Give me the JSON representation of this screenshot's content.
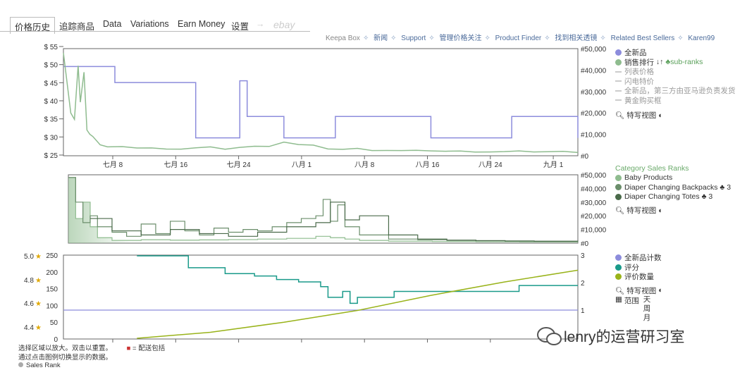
{
  "tabs": [
    "价格历史",
    "追踪商品",
    "Data",
    "Variations",
    "Earn Money",
    "设置",
    "→",
    "ebay"
  ],
  "toplinks": [
    "Keepa Box",
    "新闻",
    "Support",
    "管理价格关注",
    "Product Finder",
    "找到相关透镜",
    "Related Best Sellers",
    "Karen99"
  ],
  "main_legend": {
    "items": [
      "全新品",
      "销售排行",
      "sub-ranks",
      "列表价格",
      "闪电特价",
      "全新品，第三方由亚马逊负责发货",
      "黄金购买框"
    ],
    "sort_icon": "↓↑",
    "view": "特写视图"
  },
  "cat_legend": {
    "title": "Category Sales Ranks",
    "items": [
      "Baby Products",
      "Diaper Changing Backpacks",
      "Diaper Changing Totes"
    ],
    "counts": [
      "3",
      "3"
    ],
    "view": "特写视图"
  },
  "bottom_legend": {
    "items": [
      "全新品计数",
      "评分",
      "评价数量"
    ],
    "view": "特写视图",
    "range_label": "范围",
    "range_value": "天周月"
  },
  "notes": {
    "line1": "选择区域以放大。双击以重置。",
    "prime_legend": "= 配送包括",
    "line2": "通过点击图例切换显示的数据。",
    "line3": "Sales Rank"
  },
  "watermark": "lenry的运营研习室",
  "colors": {
    "new": "#8c8cdc",
    "salesrank": "#8fbc8f",
    "baby": "#8fbc8f",
    "backpacks": "#6b8e6b",
    "totes": "#4a6a4a",
    "count": "#8c8cdc",
    "rating": "#1a9a8a",
    "reviews": "#99b31a",
    "accent": "#5aa05a"
  },
  "chart_data": [
    {
      "type": "line",
      "title": "",
      "x_ticks": [
        "七月 8",
        "七月 16",
        "七月 24",
        "八月 1",
        "八月 8",
        "八月 16",
        "八月 24",
        "九月 1"
      ],
      "y_left_ticks": [
        "$ 25",
        "$ 30",
        "$ 35",
        "$ 40",
        "$ 45",
        "$ 50",
        "$ 55"
      ],
      "y_right_ticks": [
        "#0",
        "#10,000",
        "#20,000",
        "#30,000",
        "#40,000",
        "#50,000"
      ],
      "ylim_left": [
        25,
        55
      ],
      "ylim_right": [
        0,
        50000
      ],
      "series": [
        {
          "name": "全新品",
          "axis": "left",
          "step": true,
          "x": [
            0,
            7,
            14,
            18,
            20,
            24,
            25,
            30,
            37,
            44,
            50,
            55,
            61,
            63,
            70
          ],
          "y": [
            50,
            45.5,
            45.5,
            30,
            30,
            46,
            36,
            30,
            36,
            36,
            30,
            30,
            36,
            36,
            30
          ]
        },
        {
          "name": "销售排行",
          "axis": "right",
          "x": [
            0,
            1,
            1.5,
            2,
            2.3,
            2.8,
            3.2,
            3.6,
            4,
            5,
            6,
            8,
            10,
            12,
            14,
            16,
            18,
            20,
            22,
            24,
            26,
            28,
            30,
            32,
            34,
            36,
            38,
            40,
            42,
            44,
            46,
            48,
            50,
            52,
            54,
            56,
            58,
            60,
            62,
            64,
            66,
            68,
            70
          ],
          "y": [
            48000,
            20000,
            17000,
            42000,
            25000,
            39000,
            12000,
            10000,
            9000,
            5000,
            3800,
            4500,
            3600,
            3400,
            3500,
            3200,
            3600,
            3800,
            3300,
            3900,
            4200,
            4700,
            6500,
            5100,
            4600,
            3400,
            3000,
            3200,
            2800,
            2600,
            2300,
            2200,
            2500,
            2100,
            2000,
            2100,
            1900,
            1800,
            1900,
            2000,
            1900,
            1800,
            1900
          ]
        }
      ]
    },
    {
      "type": "area",
      "title": "Category Sales Ranks",
      "y_right_ticks": [
        "#0",
        "#10,000",
        "#20,000",
        "#30,000",
        "#40,000",
        "#50,000"
      ],
      "ylim": [
        0,
        50000
      ],
      "series": [
        {
          "name": "Baby Products",
          "x": [
            0,
            1,
            2,
            3,
            4,
            6,
            10,
            14,
            18,
            22,
            26,
            30,
            34,
            36,
            38,
            40,
            44,
            50,
            56,
            62,
            70
          ],
          "y": [
            48000,
            18000,
            30000,
            12000,
            4000,
            2000,
            2500,
            2200,
            2400,
            2600,
            3000,
            3500,
            5000,
            4000,
            3000,
            2000,
            1500,
            1200,
            1000,
            900,
            1000
          ]
        },
        {
          "name": "Diaper Changing Backpacks",
          "x": [
            0,
            1,
            2,
            3,
            4,
            6,
            8,
            10,
            12,
            14,
            16,
            18,
            20,
            22,
            24,
            26,
            28,
            30,
            32,
            34,
            35,
            36,
            37,
            38,
            40,
            44,
            48,
            52,
            56,
            60,
            64,
            70
          ],
          "y": [
            48000,
            30000,
            15000,
            20000,
            12000,
            8000,
            5000,
            14000,
            7000,
            16000,
            9000,
            6000,
            11000,
            8000,
            10000,
            9000,
            12000,
            15000,
            18000,
            20000,
            32000,
            16000,
            28000,
            12000,
            6000,
            3000,
            2500,
            2000,
            1800,
            1500,
            1300,
            1200
          ]
        },
        {
          "name": "Diaper Changing Totes",
          "x": [
            3,
            6,
            10,
            14,
            18,
            22,
            26,
            30,
            34,
            36,
            38,
            40,
            44,
            48,
            52,
            56,
            60,
            64,
            70
          ],
          "y": [
            18000,
            9000,
            6000,
            10000,
            7000,
            5000,
            8000,
            12000,
            15000,
            30000,
            17000,
            20000,
            6000,
            3000,
            2200,
            1800,
            1600,
            1400,
            1300
          ]
        }
      ]
    },
    {
      "type": "line",
      "title": "",
      "y_left_ticks": [
        "0",
        "50",
        "100",
        "150",
        "200",
        "250"
      ],
      "y_rating_ticks": [
        "4.4",
        "4.6",
        "4.8",
        "5.0"
      ],
      "y_right_ticks": [
        "1",
        "2",
        "3"
      ],
      "series": [
        {
          "name": "全新品计数",
          "axis": "right",
          "values_const": 1
        },
        {
          "name": "评分",
          "axis": "rating",
          "step": true,
          "x": [
            10,
            17,
            19,
            22,
            26,
            29,
            32,
            35,
            36,
            38,
            39,
            40,
            44,
            45,
            60,
            62
          ],
          "y": [
            5.0,
            4.9,
            4.9,
            4.85,
            4.83,
            4.8,
            4.78,
            4.74,
            4.65,
            4.7,
            4.6,
            4.65,
            4.65,
            4.7,
            4.7,
            4.75
          ]
        },
        {
          "name": "评价数量",
          "axis": "left",
          "x": [
            10,
            20,
            30,
            40,
            50,
            60,
            70
          ],
          "y": [
            2,
            20,
            50,
            85,
            130,
            170,
            205
          ]
        }
      ]
    }
  ]
}
